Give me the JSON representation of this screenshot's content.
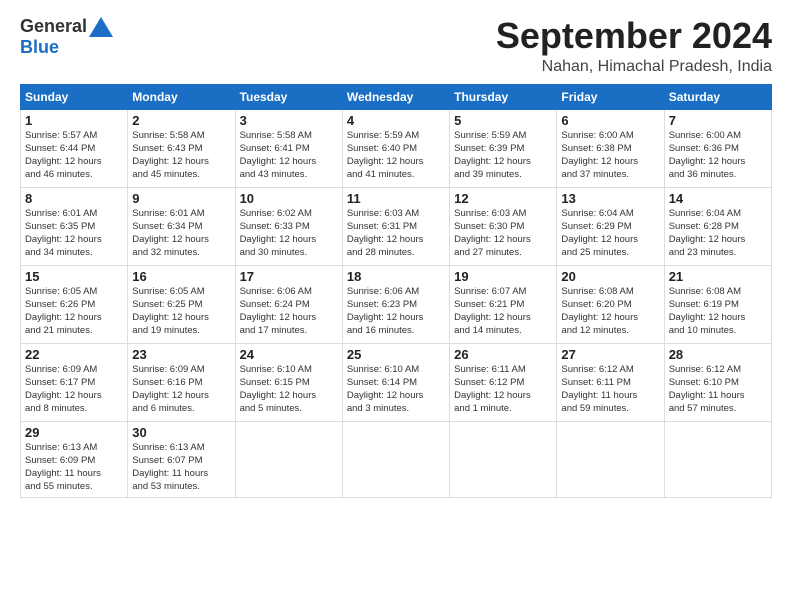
{
  "logo": {
    "general": "General",
    "blue": "Blue"
  },
  "title": "September 2024",
  "subtitle": "Nahan, Himachal Pradesh, India",
  "days_of_week": [
    "Sunday",
    "Monday",
    "Tuesday",
    "Wednesday",
    "Thursday",
    "Friday",
    "Saturday"
  ],
  "weeks": [
    [
      {
        "num": "1",
        "info": "Sunrise: 5:57 AM\nSunset: 6:44 PM\nDaylight: 12 hours\nand 46 minutes."
      },
      {
        "num": "2",
        "info": "Sunrise: 5:58 AM\nSunset: 6:43 PM\nDaylight: 12 hours\nand 45 minutes."
      },
      {
        "num": "3",
        "info": "Sunrise: 5:58 AM\nSunset: 6:41 PM\nDaylight: 12 hours\nand 43 minutes."
      },
      {
        "num": "4",
        "info": "Sunrise: 5:59 AM\nSunset: 6:40 PM\nDaylight: 12 hours\nand 41 minutes."
      },
      {
        "num": "5",
        "info": "Sunrise: 5:59 AM\nSunset: 6:39 PM\nDaylight: 12 hours\nand 39 minutes."
      },
      {
        "num": "6",
        "info": "Sunrise: 6:00 AM\nSunset: 6:38 PM\nDaylight: 12 hours\nand 37 minutes."
      },
      {
        "num": "7",
        "info": "Sunrise: 6:00 AM\nSunset: 6:36 PM\nDaylight: 12 hours\nand 36 minutes."
      }
    ],
    [
      {
        "num": "8",
        "info": "Sunrise: 6:01 AM\nSunset: 6:35 PM\nDaylight: 12 hours\nand 34 minutes."
      },
      {
        "num": "9",
        "info": "Sunrise: 6:01 AM\nSunset: 6:34 PM\nDaylight: 12 hours\nand 32 minutes."
      },
      {
        "num": "10",
        "info": "Sunrise: 6:02 AM\nSunset: 6:33 PM\nDaylight: 12 hours\nand 30 minutes."
      },
      {
        "num": "11",
        "info": "Sunrise: 6:03 AM\nSunset: 6:31 PM\nDaylight: 12 hours\nand 28 minutes."
      },
      {
        "num": "12",
        "info": "Sunrise: 6:03 AM\nSunset: 6:30 PM\nDaylight: 12 hours\nand 27 minutes."
      },
      {
        "num": "13",
        "info": "Sunrise: 6:04 AM\nSunset: 6:29 PM\nDaylight: 12 hours\nand 25 minutes."
      },
      {
        "num": "14",
        "info": "Sunrise: 6:04 AM\nSunset: 6:28 PM\nDaylight: 12 hours\nand 23 minutes."
      }
    ],
    [
      {
        "num": "15",
        "info": "Sunrise: 6:05 AM\nSunset: 6:26 PM\nDaylight: 12 hours\nand 21 minutes."
      },
      {
        "num": "16",
        "info": "Sunrise: 6:05 AM\nSunset: 6:25 PM\nDaylight: 12 hours\nand 19 minutes."
      },
      {
        "num": "17",
        "info": "Sunrise: 6:06 AM\nSunset: 6:24 PM\nDaylight: 12 hours\nand 17 minutes."
      },
      {
        "num": "18",
        "info": "Sunrise: 6:06 AM\nSunset: 6:23 PM\nDaylight: 12 hours\nand 16 minutes."
      },
      {
        "num": "19",
        "info": "Sunrise: 6:07 AM\nSunset: 6:21 PM\nDaylight: 12 hours\nand 14 minutes."
      },
      {
        "num": "20",
        "info": "Sunrise: 6:08 AM\nSunset: 6:20 PM\nDaylight: 12 hours\nand 12 minutes."
      },
      {
        "num": "21",
        "info": "Sunrise: 6:08 AM\nSunset: 6:19 PM\nDaylight: 12 hours\nand 10 minutes."
      }
    ],
    [
      {
        "num": "22",
        "info": "Sunrise: 6:09 AM\nSunset: 6:17 PM\nDaylight: 12 hours\nand 8 minutes."
      },
      {
        "num": "23",
        "info": "Sunrise: 6:09 AM\nSunset: 6:16 PM\nDaylight: 12 hours\nand 6 minutes."
      },
      {
        "num": "24",
        "info": "Sunrise: 6:10 AM\nSunset: 6:15 PM\nDaylight: 12 hours\nand 5 minutes."
      },
      {
        "num": "25",
        "info": "Sunrise: 6:10 AM\nSunset: 6:14 PM\nDaylight: 12 hours\nand 3 minutes."
      },
      {
        "num": "26",
        "info": "Sunrise: 6:11 AM\nSunset: 6:12 PM\nDaylight: 12 hours\nand 1 minute."
      },
      {
        "num": "27",
        "info": "Sunrise: 6:12 AM\nSunset: 6:11 PM\nDaylight: 11 hours\nand 59 minutes."
      },
      {
        "num": "28",
        "info": "Sunrise: 6:12 AM\nSunset: 6:10 PM\nDaylight: 11 hours\nand 57 minutes."
      }
    ],
    [
      {
        "num": "29",
        "info": "Sunrise: 6:13 AM\nSunset: 6:09 PM\nDaylight: 11 hours\nand 55 minutes."
      },
      {
        "num": "30",
        "info": "Sunrise: 6:13 AM\nSunset: 6:07 PM\nDaylight: 11 hours\nand 53 minutes."
      },
      {
        "num": "",
        "info": ""
      },
      {
        "num": "",
        "info": ""
      },
      {
        "num": "",
        "info": ""
      },
      {
        "num": "",
        "info": ""
      },
      {
        "num": "",
        "info": ""
      }
    ]
  ]
}
